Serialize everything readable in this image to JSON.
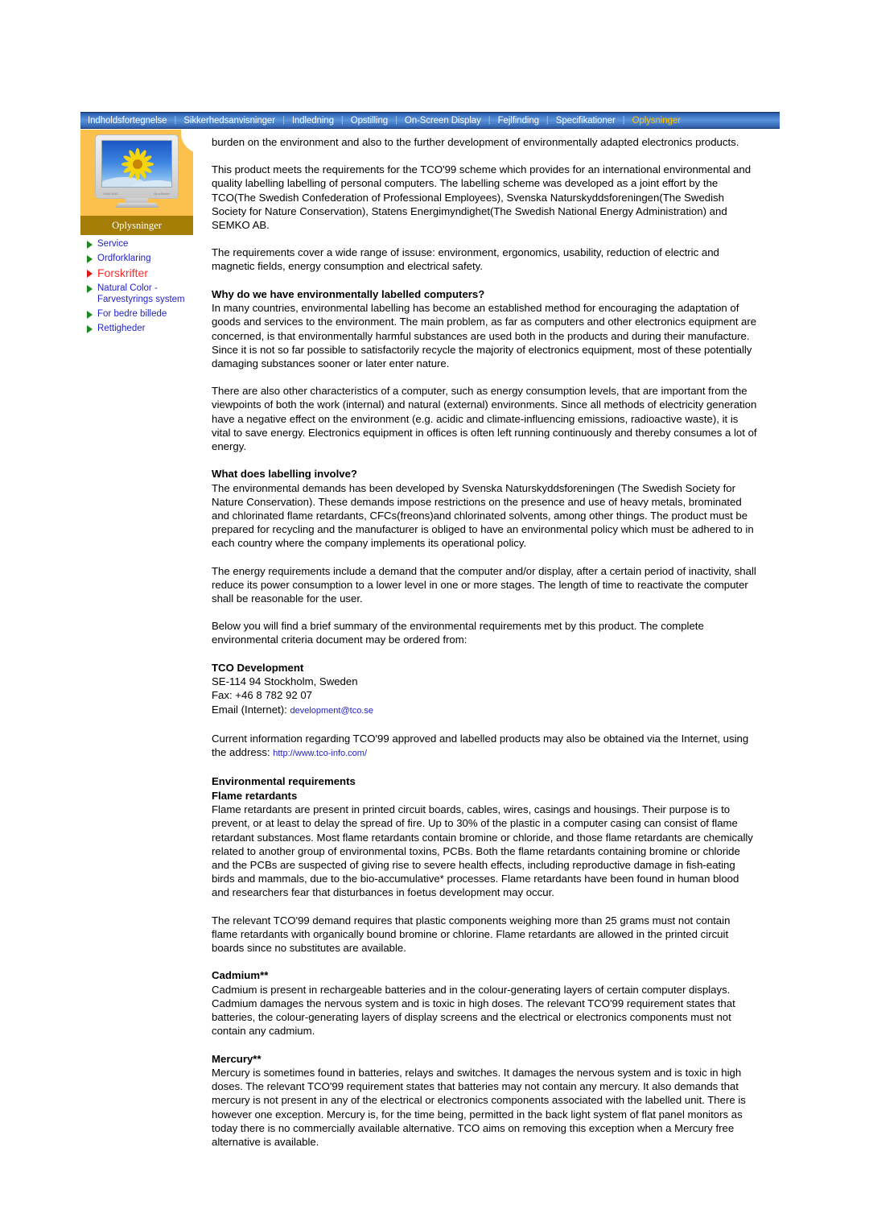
{
  "navbar": {
    "separator": "|",
    "items": [
      {
        "label": "Indholdsfortegnelse",
        "active": false
      },
      {
        "label": "Sikkerhedsanvisninger",
        "active": false
      },
      {
        "label": "Indledning",
        "active": false
      },
      {
        "label": "Opstilling",
        "active": false
      },
      {
        "label": "On-Screen Display",
        "active": false
      },
      {
        "label": "Fejlfinding",
        "active": false
      },
      {
        "label": "Specifikationer",
        "active": false
      },
      {
        "label": "Oplysninger",
        "active": true
      }
    ],
    "active_color": "#ffc400",
    "bar_color": "#3a71c0"
  },
  "sidebar": {
    "thumbnail_caption": "Oplysninger",
    "panel_color": "#fbc14c",
    "caption_color": "#a47c06",
    "monitor_brand_left": "SAMSUNG",
    "monitor_brand_right": "SyncMaster",
    "items": [
      {
        "label": "Service",
        "active": false
      },
      {
        "label": "Ordforklaring",
        "active": false
      },
      {
        "label": "Forskrifter",
        "active": true
      },
      {
        "label": "Natural Color - Farvestyrings system",
        "active": false
      },
      {
        "label": "For bedre billede",
        "active": false
      },
      {
        "label": "Rettigheder",
        "active": false
      }
    ],
    "bullet_color": "#1e8a22",
    "bullet_active_color": "#e01414",
    "link_color": "#2222cc",
    "active_link_color": "#ff2a2a"
  },
  "content": {
    "p_intro": "burden on the environment and also to the further development of environmentally adapted electronics products.",
    "p_scheme": "This product meets the requirements for the TCO'99 scheme which provides for an international environmental and quality labelling labelling of personal computers. The labelling scheme was developed as a joint effort by the TCO(The Swedish Confederation of Professional Employees), Svenska Naturskyddsforeningen(The Swedish Society for Nature Conservation), Statens Energimyndighet(The Swedish National Energy Administration) and SEMKO AB.",
    "p_requirements": "The requirements cover a wide range of issuse: environment, ergonomics, usability, reduction of electric and magnetic fields, energy consumption and electrical safety.",
    "h_why": "Why do we have environmentally labelled computers?",
    "p_why": "In many countries, environmental labelling has become an established method for encouraging the adaptation of goods and services to the environment. The main problem, as far as computers and other electronics equipment are concerned, is that environmentally harmful substances are used both in the products and during their manufacture. Since it is not so far possible to satisfactorily recycle the majority of electronics equipment, most of these potentially damaging substances sooner or later enter nature.",
    "p_characteristics": "There are also other characteristics of a computer, such as energy consumption levels, that are important from the viewpoints of both the work (internal) and natural (external) environments. Since all methods of electricity generation have a negative effect on the environment (e.g. acidic and climate-influencing emissions, radioactive waste), it is vital to save energy. Electronics equipment in offices is often left running continuously and thereby consumes a lot of energy.",
    "h_labelling": "What does labelling involve?",
    "p_labelling": "The environmental demands has been developed by Svenska Naturskyddsforeningen (The Swedish Society for Nature Conservation). These demands impose restrictions on the presence and use of heavy metals, brominated and chlorinated flame retardants, CFCs(freons)and chlorinated solvents, among other things. The product must be prepared for recycling and the manufacturer is obliged to have an environmental policy which must be adhered to in each country where the company implements its operational policy.",
    "p_energy": "The energy requirements include a demand that the computer and/or display, after a certain period of inactivity, shall reduce its power consumption to a lower level in one or more stages. The length of time to reactivate the computer shall be reasonable for the user.",
    "p_below": "Below you will find a brief summary of the environmental requirements met by this product. The complete environmental criteria document may be ordered from:",
    "h_tco": "TCO Development",
    "addr_line1": "SE-114 94 Stockholm, Sweden",
    "addr_line2": "Fax: +46 8 782 92 07",
    "addr_email_label": "Email (Internet): ",
    "addr_email": "development@tco.se",
    "p_current_1": "Current information regarding TCO'99 approved and labelled products may also be obtained via the Internet, using the address: ",
    "current_url": "http://www.tco-info.com/",
    "h_env": "Environmental requirements",
    "h_flame": "Flame retardants",
    "p_flame": "Flame retardants are present in printed circuit boards, cables, wires, casings and housings. Their purpose is to prevent, or at least to delay the spread of fire. Up to 30% of the plastic in a computer casing can consist of flame retardant substances. Most flame retardants contain bromine or chloride, and those flame retardants are chemically related to another group of environmental toxins, PCBs. Both the flame retardants containing bromine or chloride and the PCBs are suspected of giving rise to severe health effects, including reproductive damage in fish-eating birds and mammals, due to the bio-accumulative* processes. Flame retardants have been found in human blood and researchers fear that disturbances in foetus development may occur.",
    "p_relevant": "The relevant TCO'99 demand requires that plastic components weighing more than 25 grams must not contain flame retardants with organically bound bromine or chlorine. Flame retardants are allowed in the printed circuit boards since no substitutes are available.",
    "h_cadmium": "Cadmium**",
    "p_cadmium": "Cadmium is present in rechargeable batteries and in the colour-generating layers of certain computer displays. Cadmium damages the nervous system and is toxic in high doses. The relevant TCO'99 requirement states that batteries, the colour-generating layers of display screens and the electrical or electronics components must not contain any cadmium.",
    "h_mercury": "Mercury**",
    "p_mercury": "Mercury is sometimes found in batteries, relays and switches. It damages the nervous system and is toxic in high doses. The relevant TCO'99 requirement states that batteries may not contain any mercury. It also demands that mercury is not present in any of the electrical or electronics components associated with the labelled unit. There is however one exception. Mercury is, for the time being, permitted in the back light system of flat panel monitors as today there is no commercially available alternative. TCO aims on removing this exception when a Mercury free alternative is available."
  }
}
